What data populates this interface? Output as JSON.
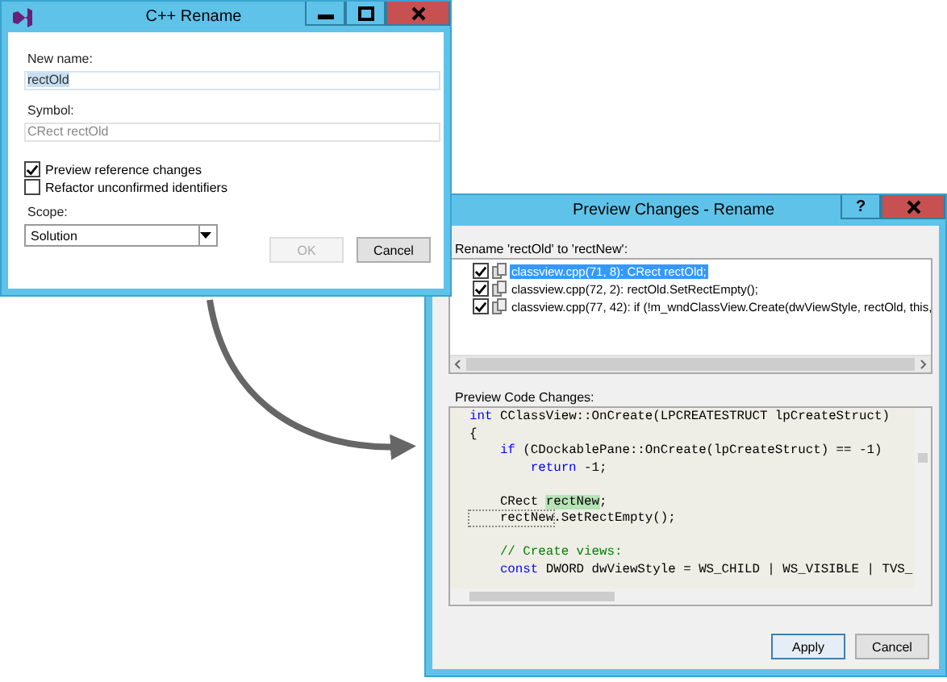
{
  "rename_dialog": {
    "title": "C++ Rename",
    "new_name_label": "New name:",
    "new_name_value": "rectOld",
    "symbol_label": "Symbol:",
    "symbol_value": "CRect rectOld",
    "options": [
      {
        "label": "Preview reference changes",
        "checked": true
      },
      {
        "label": "Refactor unconfirmed identifiers",
        "checked": false
      }
    ],
    "scope_label": "Scope:",
    "scope_value": "Solution",
    "buttons": [
      {
        "label": "OK",
        "disabled": true
      },
      {
        "label": "Cancel",
        "disabled": false
      }
    ]
  },
  "preview_dialog": {
    "title": "Preview Changes - Rename",
    "help": "?",
    "rename_label": "Rename 'rectOld' to 'rectNew':",
    "references": [
      {
        "text": "classview.cpp(71, 8): CRect rectOld;",
        "checked": true,
        "selected": true
      },
      {
        "text": "classview.cpp(72, 2): rectOld.SetRectEmpty();",
        "checked": true,
        "selected": false
      },
      {
        "text": "classview.cpp(77, 42): if (!m_wndClassView.Create(dwViewStyle, rectOld, this,",
        "checked": true,
        "selected": false
      }
    ],
    "code_label": "Preview Code Changes:",
    "code_lines": [
      {
        "segments": [
          {
            "text": "int",
            "kind": "keyword"
          },
          {
            "text": " CClassView::OnCreate(LPCREATESTRUCT lpCreateStruct)",
            "kind": "plain"
          }
        ]
      },
      {
        "segments": [
          {
            "text": "{",
            "kind": "plain"
          }
        ]
      },
      {
        "segments": [
          {
            "text": "    if",
            "kind": "keyword"
          },
          {
            "text": " (CDockablePane::OnCreate(lpCreateStruct) == -1)",
            "kind": "plain"
          }
        ]
      },
      {
        "segments": [
          {
            "text": "        return",
            "kind": "keyword"
          },
          {
            "text": " -1;",
            "kind": "plain"
          }
        ]
      },
      {
        "space_before": true,
        "segments": [
          {
            "text": "    CRect ",
            "kind": "plain"
          },
          {
            "text": "rectNew",
            "kind": "highlight"
          },
          {
            "text": ";",
            "kind": "plain"
          }
        ]
      },
      {
        "segments": [
          {
            "text": "    rectNew",
            "kind": "boxed"
          },
          {
            "text": ".SetRectEmpty();",
            "kind": "plain"
          }
        ]
      },
      {
        "space_before": true,
        "segments": [
          {
            "text": "    // Create views:",
            "kind": "comment"
          }
        ]
      },
      {
        "segments": [
          {
            "text": "    const",
            "kind": "keyword"
          },
          {
            "text": " DWORD dwViewStyle = WS_CHILD | WS_VISIBLE | TVS_",
            "kind": "plain"
          }
        ]
      }
    ],
    "buttons": [
      {
        "label": "Apply",
        "default": true
      },
      {
        "label": "Cancel",
        "default": false
      }
    ]
  }
}
